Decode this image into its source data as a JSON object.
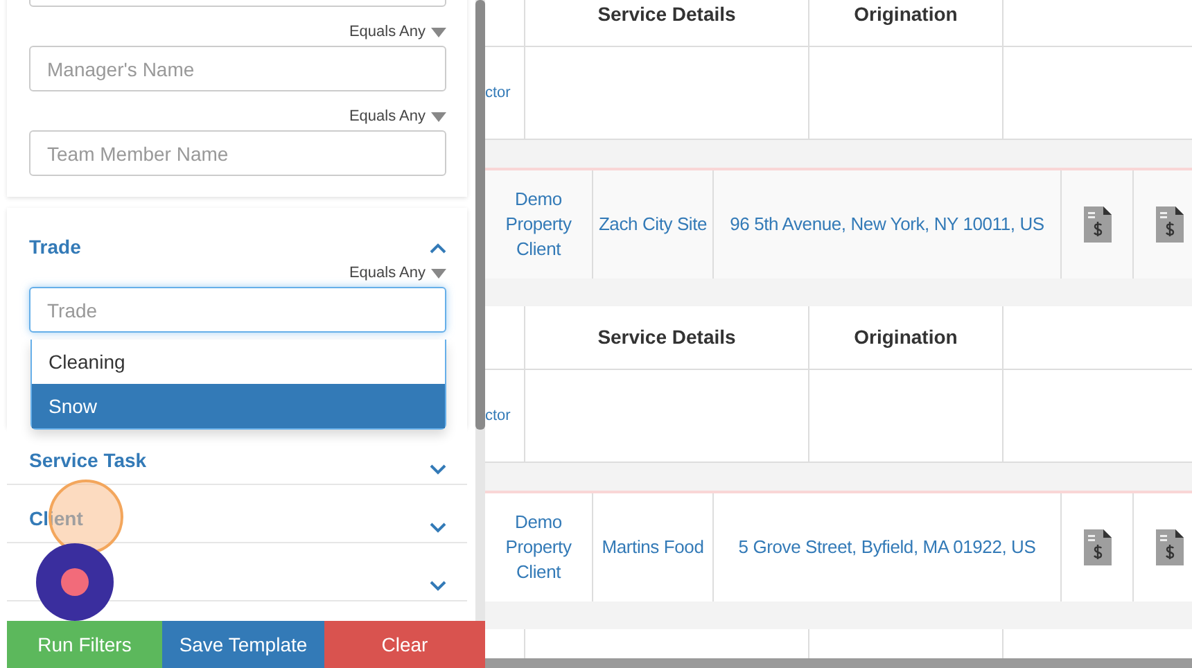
{
  "filters": [
    {
      "operator": "Equals Any",
      "placeholder": "Manager's Name"
    },
    {
      "operator": "Equals Any",
      "placeholder": "Team Member Name"
    }
  ],
  "trade": {
    "title": "Trade",
    "expanded": true,
    "operator": "Equals Any",
    "placeholder": "Trade",
    "options": [
      {
        "label": "Cleaning",
        "selected": false
      },
      {
        "label": "Snow",
        "selected": true
      }
    ]
  },
  "sections": [
    {
      "title": "Service Task",
      "expanded": false
    },
    {
      "title": "Client",
      "expanded": false
    },
    {
      "expanded": false
    }
  ],
  "buttons": [
    {
      "label": "Run Filters",
      "kind": "success"
    },
    {
      "label": "Save Template",
      "kind": "primary"
    },
    {
      "label": "Clear",
      "kind": "danger"
    }
  ],
  "table": {
    "blocks": [
      {
        "headers": [
          "Service Details",
          "Origination"
        ],
        "first_cell": "ctor",
        "cells": [
          "Demo Property Client",
          "Zach City Site",
          "96 5th Avenue, New York, NY 10011, US"
        ]
      },
      {
        "headers": [
          "Service Details",
          "Origination"
        ],
        "first_cell": "ctor",
        "cells": [
          "Demo Property Client",
          "Martins Food",
          "5 Grove Street, Byfield, MA 01922, US"
        ]
      }
    ]
  }
}
